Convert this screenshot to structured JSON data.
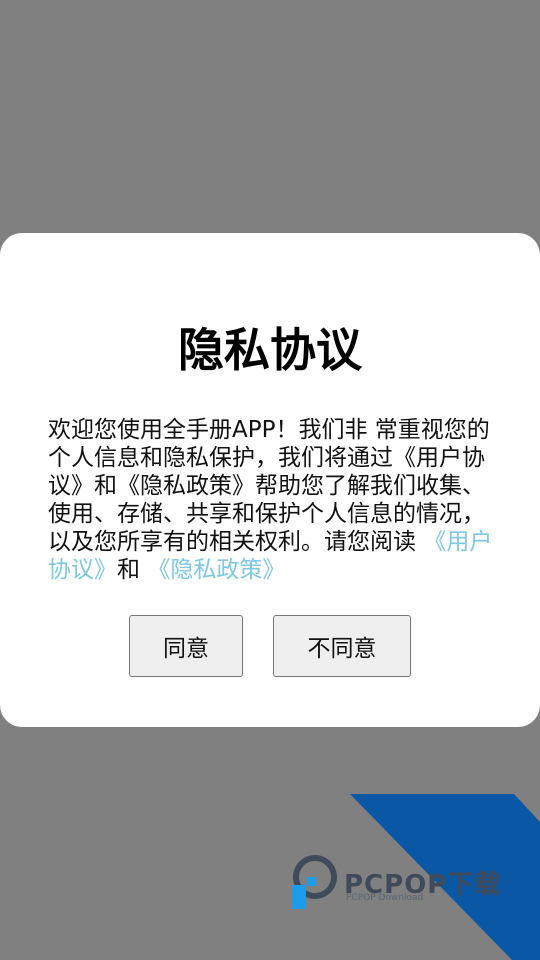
{
  "dialog": {
    "title": "隐私协议",
    "body_prefix": "欢迎您使用全手册APP！我们非 常重视您的个人信息和隐私保护，我们将通过《用户协议》和《隐私政策》帮助您了解我们收集、使用、存储、共享和保护个人信息的情况，以及您所享有的相关权利。请您阅读 ",
    "link_user_agreement": "《用户协议》",
    "connector": "和 ",
    "link_privacy_policy": "《隐私政策》",
    "agree_label": "同意",
    "disagree_label": "不同意"
  },
  "watermark": {
    "brand": "PCPOP下载",
    "sub": "PCPOP Download",
    "color_band": "#0a57a6"
  },
  "colors": {
    "backdrop": "#808080",
    "link": "#7ec8e3"
  }
}
